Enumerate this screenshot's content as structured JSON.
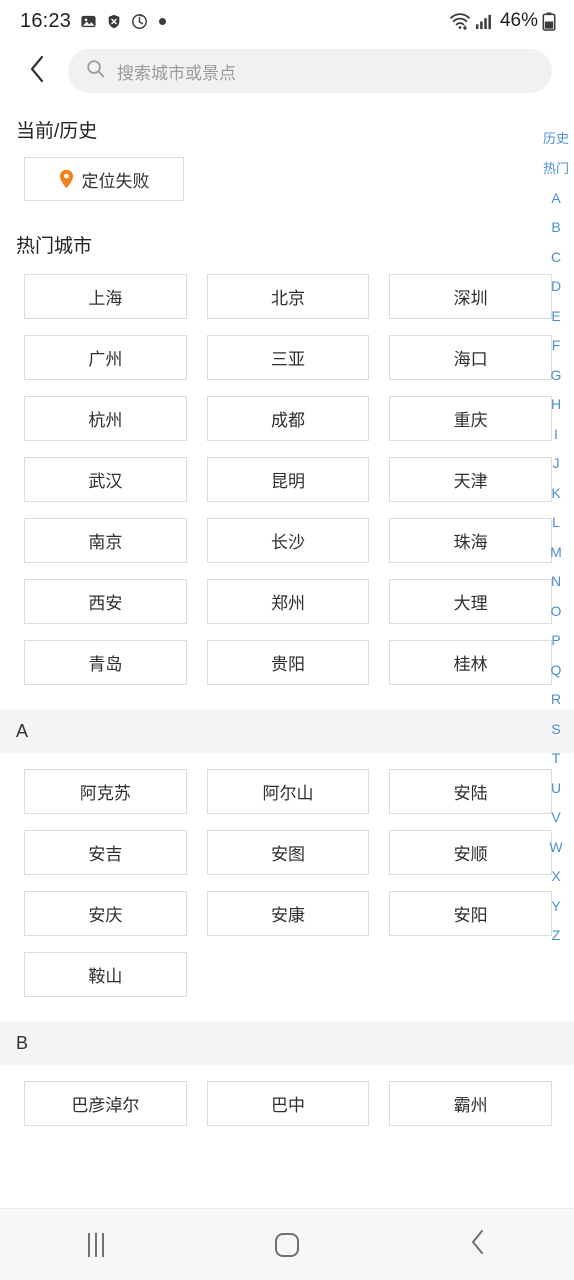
{
  "status_bar": {
    "time": "16:23",
    "left_icons": [
      "gallery-icon",
      "shield-off-icon",
      "data-saver-icon",
      "dot-icon"
    ],
    "wifi_icon": "wifi-icon",
    "signal_icon": "cellular-signal-icon",
    "battery_text": "46%",
    "battery_icon": "battery-icon"
  },
  "header": {
    "back_icon": "chevron-left-icon",
    "search_icon": "search-icon",
    "search_placeholder": "搜索城市或景点",
    "search_value": ""
  },
  "current_history": {
    "title": "当前/历史",
    "locate_button_label": "定位失败",
    "locate_icon": "map-pin-icon",
    "locate_icon_color": "#f0821e"
  },
  "hot_cities": {
    "title": "热门城市",
    "cities": [
      "上海",
      "北京",
      "深圳",
      "广州",
      "三亚",
      "海口",
      "杭州",
      "成都",
      "重庆",
      "武汉",
      "昆明",
      "天津",
      "南京",
      "长沙",
      "珠海",
      "西安",
      "郑州",
      "大理",
      "青岛",
      "贵阳",
      "桂林"
    ]
  },
  "sections": [
    {
      "letter": "A",
      "cities": [
        "阿克苏",
        "阿尔山",
        "安陆",
        "安吉",
        "安图",
        "安顺",
        "安庆",
        "安康",
        "安阳",
        "鞍山"
      ]
    },
    {
      "letter": "B",
      "cities": [
        "巴彦淖尔",
        "巴中",
        "霸州"
      ]
    }
  ],
  "index_bar": {
    "accent_color": "#4a8fd4",
    "items": [
      "历史",
      "热门",
      "A",
      "B",
      "C",
      "D",
      "E",
      "F",
      "G",
      "H",
      "I",
      "J",
      "K",
      "L",
      "M",
      "N",
      "O",
      "P",
      "Q",
      "R",
      "S",
      "T",
      "U",
      "V",
      "W",
      "X",
      "Y",
      "Z"
    ]
  },
  "nav_bar": {
    "recents_label": "recents-icon",
    "home_label": "home-icon",
    "back_label": "back-icon"
  }
}
